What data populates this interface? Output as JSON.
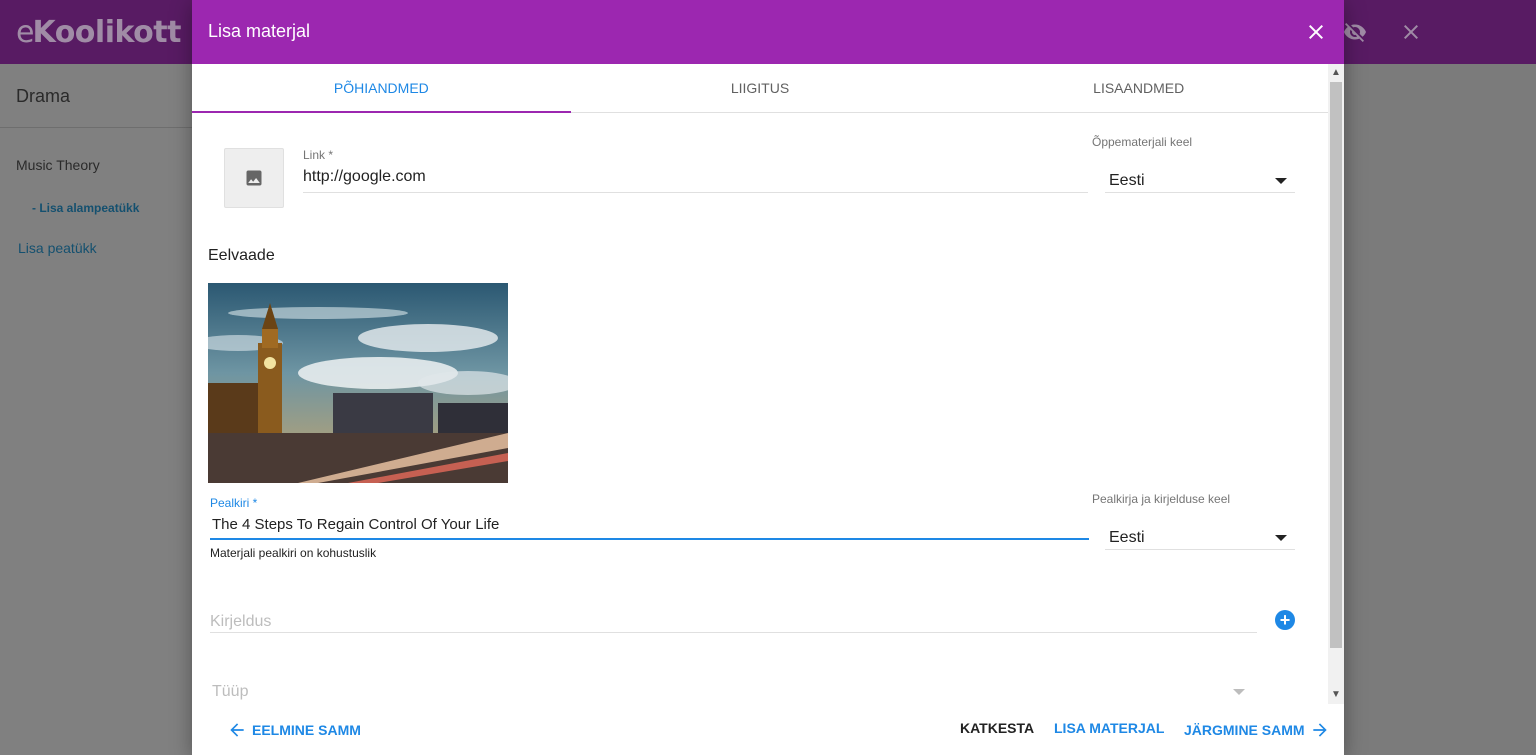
{
  "app": {
    "logo_text": "Koolikott",
    "logo_prefix": "e"
  },
  "sidebar": {
    "title": "Drama",
    "chapter": "Music Theory",
    "add_subchapter": "- Lisa alampeatükk",
    "add_chapter": "Lisa peatükk"
  },
  "dialog": {
    "title": "Lisa materjal",
    "tabs": [
      {
        "label": "PÕHIANDMED",
        "active": true
      },
      {
        "label": "LIIGITUS",
        "active": false
      },
      {
        "label": "LISAANDMED",
        "active": false
      }
    ],
    "link": {
      "label": "Link *",
      "value": "http://google.com"
    },
    "material_language": {
      "label": "Õppematerjali keel",
      "value": "Eesti"
    },
    "preview_title": "Eelvaade",
    "title_field": {
      "label": "Pealkiri *",
      "value": "The 4 Steps To Regain Control Of Your Life",
      "helper": "Materjali pealkiri on kohustuslik"
    },
    "title_language": {
      "label": "Pealkirja ja kirjelduse keel",
      "value": "Eesti"
    },
    "description": {
      "placeholder": "Kirjeldus"
    },
    "type": {
      "placeholder": "Tüüp"
    },
    "footer": {
      "previous": "EELMINE SAMM",
      "cancel": "KATKESTA",
      "add_material": "LISA MATERJAL",
      "next": "JÄRGMINE SAMM"
    }
  },
  "colors": {
    "header": "#9c27b0",
    "accent": "#1e88e5"
  }
}
